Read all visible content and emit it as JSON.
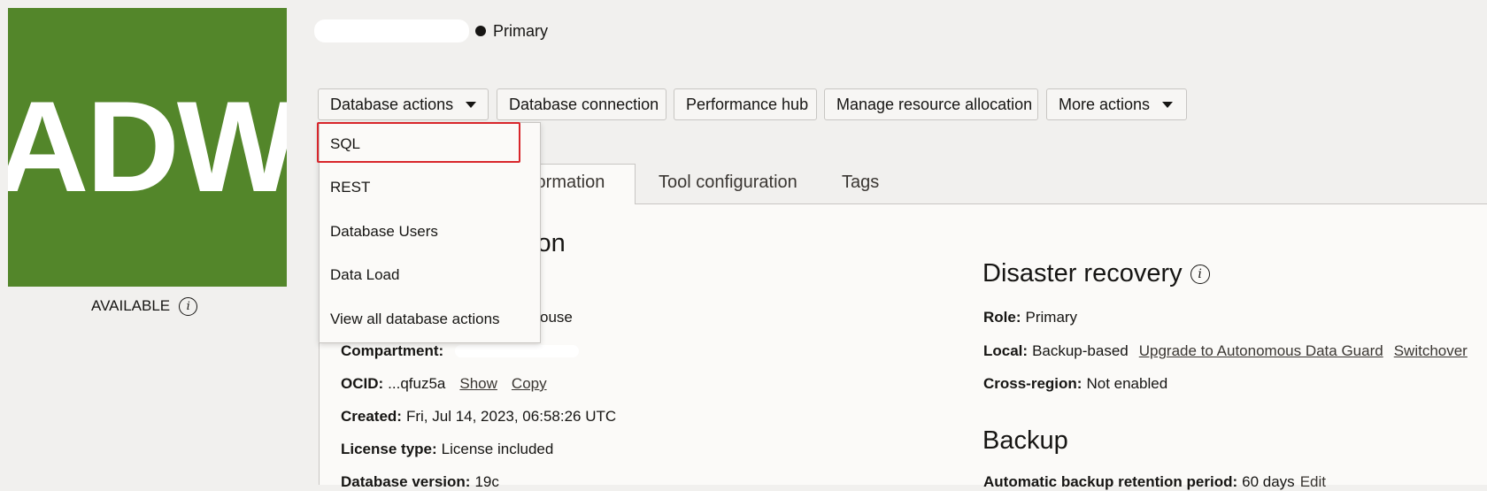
{
  "tile": {
    "text": "ADW",
    "color": "#53862a"
  },
  "status": {
    "label": "AVAILABLE",
    "icon": "info-icon"
  },
  "header": {
    "role_label": "Primary"
  },
  "actions": [
    {
      "label": "Database actions",
      "has_caret": true
    },
    {
      "label": "Database connection"
    },
    {
      "label": "Performance hub"
    },
    {
      "label": "Manage resource allocation"
    },
    {
      "label": "More actions",
      "has_caret": true
    }
  ],
  "menu": {
    "items": [
      "SQL",
      "REST",
      "Database Users",
      "Data Load",
      "View all database actions"
    ],
    "highlighted": "SQL",
    "highlight_color": "#d8262b"
  },
  "tabs": {
    "active_partial": "formation",
    "others": [
      "Tool configuration",
      "Tags"
    ]
  },
  "general": {
    "heading_partial": "ion",
    "workload_partial": "ouse",
    "compartment_label": "Compartment:",
    "ocid_label": "OCID:",
    "ocid_value": "...qfuz5a",
    "ocid_show": "Show",
    "ocid_copy": "Copy",
    "created_label": "Created:",
    "created_value": "Fri, Jul 14, 2023, 06:58:26 UTC",
    "license_label": "License type:",
    "license_value": "License included",
    "version_label": "Database version:",
    "version_value": "19c"
  },
  "disaster_recovery": {
    "heading": "Disaster recovery",
    "role_label": "Role:",
    "role_value": "Primary",
    "local_label": "Local:",
    "local_value": "Backup-based",
    "upgrade_link": "Upgrade to Autonomous Data Guard",
    "switchover_link": "Switchover",
    "cross_label": "Cross-region:",
    "cross_value": "Not enabled"
  },
  "backup": {
    "heading": "Backup",
    "retention_label": "Automatic backup retention period:",
    "retention_value": "60 days",
    "edit_link": "Edit"
  }
}
